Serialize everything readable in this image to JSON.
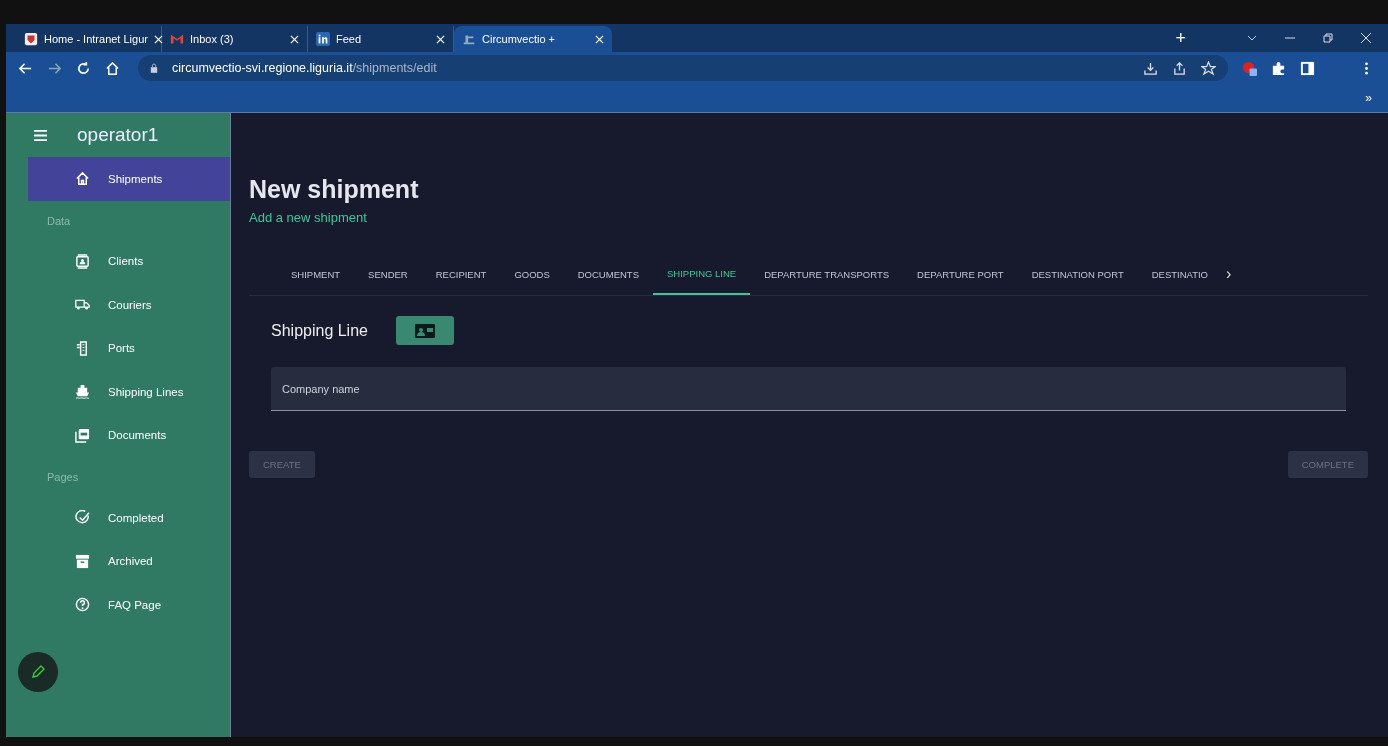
{
  "browser": {
    "tabs": [
      {
        "title": "Home - Intranet Ligur",
        "selected": false
      },
      {
        "title": "Inbox (3)",
        "selected": false
      },
      {
        "title": "Feed",
        "selected": false
      },
      {
        "title": "Circumvectio +",
        "selected": true
      }
    ],
    "new_tab": "+",
    "address": {
      "host": "circumvectio-svi.regione.liguria.it",
      "path": "/shipments/edit"
    },
    "bookmarks_more": "»"
  },
  "sidebar": {
    "user": "operator1",
    "sections": [
      {
        "items": [
          {
            "label": "Shipments",
            "selected": true
          }
        ]
      },
      {
        "heading": "Data",
        "items": [
          {
            "label": "Clients",
            "selected": false
          },
          {
            "label": "Couriers",
            "selected": false
          },
          {
            "label": "Ports",
            "selected": false
          },
          {
            "label": "Shipping Lines",
            "selected": false
          },
          {
            "label": "Documents",
            "selected": false
          }
        ]
      },
      {
        "heading": "Pages",
        "items": [
          {
            "label": "Completed",
            "selected": false
          },
          {
            "label": "Archived",
            "selected": false
          },
          {
            "label": "FAQ Page",
            "selected": false
          }
        ]
      }
    ]
  },
  "page": {
    "title": "New shipment",
    "subtitle": "Add a new shipment",
    "tabs": [
      {
        "label": "SHIPMENT",
        "selected": false
      },
      {
        "label": "SENDER",
        "selected": false
      },
      {
        "label": "RECIPIENT",
        "selected": false
      },
      {
        "label": "GOODS",
        "selected": false
      },
      {
        "label": "DOCUMENTS",
        "selected": false
      },
      {
        "label": "SHIPPING LINE",
        "selected": true
      },
      {
        "label": "DEPARTURE TRANSPORTS",
        "selected": false
      },
      {
        "label": "DEPARTURE PORT",
        "selected": false
      },
      {
        "label": "DESTINATION PORT",
        "selected": false
      },
      {
        "label": "DESTINATIO",
        "selected": false
      }
    ],
    "tabs_next": "›",
    "section": "Shipping Line",
    "field": {
      "placeholder": "Company name"
    },
    "buttons": [
      {
        "label": "CREATE",
        "disabled": true
      },
      {
        "label": "COMPLETE",
        "disabled": true
      }
    ]
  }
}
